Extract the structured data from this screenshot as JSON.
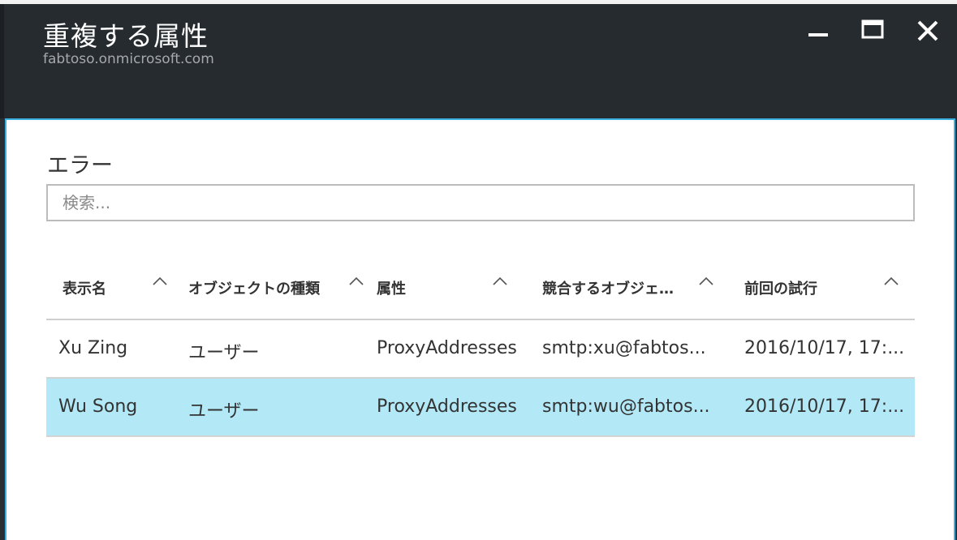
{
  "window": {
    "title": "重複する属性",
    "subtitle": "fabtoso.onmicrosoft.com",
    "controls": [
      "minimize-icon",
      "maximize-icon",
      "close-icon"
    ]
  },
  "errors": {
    "section_title": "エラー",
    "search_placeholder": "検索...",
    "columns": [
      "表示名",
      "オブジェクトの種類",
      "属性",
      "競合するオブジェ…",
      "前回の試行"
    ],
    "rows": [
      {
        "display_name": "Xu Zing",
        "object_type": "ユーザー",
        "attribute": "ProxyAddresses",
        "conflicting_object": "smtp:xu@fabtos...",
        "last_attempt": "2016/10/17, 17:...",
        "selected": false
      },
      {
        "display_name": "Wu Song",
        "object_type": "ユーザー",
        "attribute": "ProxyAddresses",
        "conflicting_object": "smtp:wu@fabtos...",
        "last_attempt": "2016/10/17, 17:...",
        "selected": true
      }
    ]
  },
  "colors": {
    "header_bg": "#262b30",
    "panel_border": "#3ab0e0",
    "selected_row": "#b3e9f7"
  }
}
